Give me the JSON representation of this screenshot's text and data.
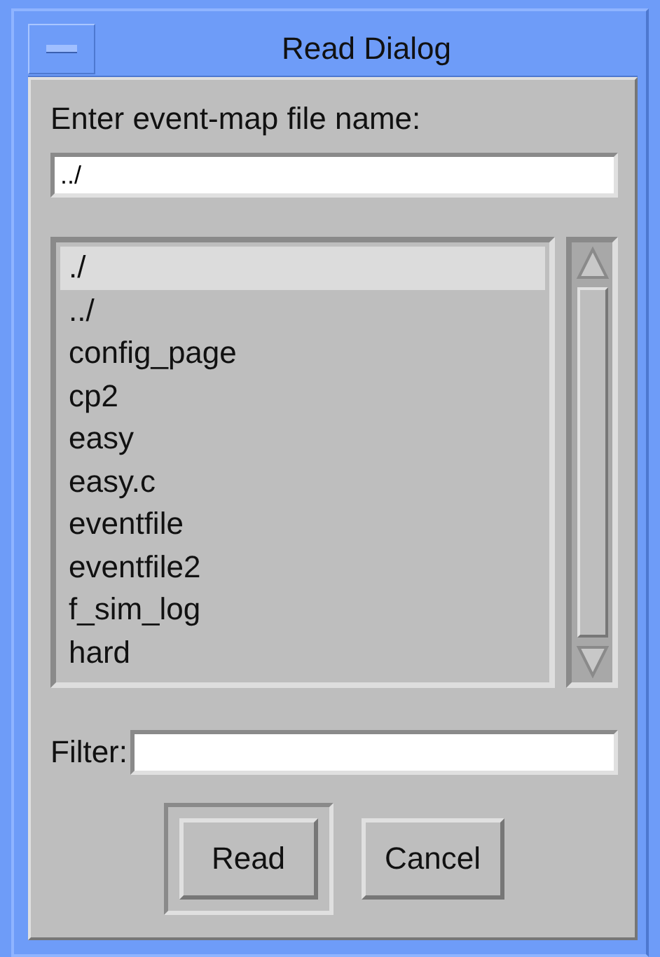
{
  "window": {
    "title": "Read Dialog"
  },
  "prompt": "Enter event-map file name:",
  "file_name": {
    "value": "../"
  },
  "files": [
    {
      "name": "./",
      "selected": true
    },
    {
      "name": "../",
      "selected": false
    },
    {
      "name": "config_page",
      "selected": false
    },
    {
      "name": "cp2",
      "selected": false
    },
    {
      "name": "easy",
      "selected": false
    },
    {
      "name": "easy.c",
      "selected": false
    },
    {
      "name": "eventfile",
      "selected": false
    },
    {
      "name": "eventfile2",
      "selected": false
    },
    {
      "name": "f_sim_log",
      "selected": false
    },
    {
      "name": "hard",
      "selected": false
    }
  ],
  "filter": {
    "label": "Filter:"
  },
  "buttons": [
    {
      "label": "Read",
      "default": true
    },
    {
      "label": "Cancel",
      "default": false
    }
  ]
}
